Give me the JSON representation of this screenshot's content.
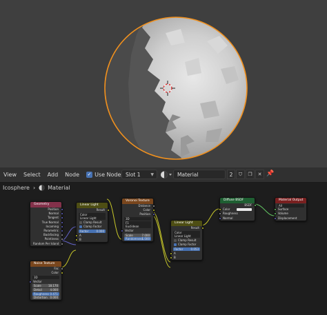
{
  "header": {
    "menu": [
      "View",
      "Select",
      "Add",
      "Node"
    ],
    "use_nodes_label": "Use Nodes",
    "slot_label": "Slot 1",
    "material_name": "Material",
    "user_count": "2"
  },
  "breadcrumb": {
    "object": "Icosphere",
    "material": "Material"
  },
  "nodes": {
    "geometry": {
      "title": "Geometry",
      "outputs": [
        "Position",
        "Normal",
        "Tangent",
        "True Normal",
        "Incoming",
        "Parametric",
        "Backfacing",
        "Pointiness",
        "Random Per Island"
      ]
    },
    "mix1": {
      "title": "Linear Light",
      "result": "Result",
      "type": "Color",
      "mode": "Linear Light",
      "clamp_result": "Clamp Result",
      "clamp_factor": "Clamp Factor",
      "factor_label": "Factor",
      "factor_value": "0.000",
      "a": "A",
      "b": "B"
    },
    "noise": {
      "title": "Noise Texture",
      "fac": "Fac",
      "color": "Color",
      "dim": "3D",
      "vector": "Vector",
      "scale_label": "Scale",
      "scale_value": "18.170",
      "detail_label": "Detail",
      "detail_value": "4.000",
      "rough_label": "Roughness",
      "rough_value": "0.471",
      "distortion_label": "Distortion",
      "distortion_value": "0.000"
    },
    "voronoi": {
      "title": "Voronoi Texture",
      "distance": "Distance",
      "color": "Color",
      "position": "Position",
      "dim": "3D",
      "feature": "F1",
      "metric": "Euclidean",
      "vector": "Vector",
      "scale_label": "Scale",
      "scale_value": "7.000",
      "random_label": "Randomness",
      "random_value": "1.000"
    },
    "mix2": {
      "title": "Linear Light",
      "result": "Result",
      "type": "Color",
      "mode": "Linear Light",
      "clamp_result": "Clamp Result",
      "clamp_factor": "Clamp Factor",
      "factor_label": "Factor",
      "factor_value": "0.053",
      "a": "A",
      "b": "B"
    },
    "bsdf": {
      "title": "Diffuse BSDF",
      "bsdf": "BSDF",
      "color": "Color",
      "roughness": "Roughness",
      "normal": "Normal"
    },
    "output": {
      "title": "Material Output",
      "target": "All",
      "surface": "Surface",
      "volume": "Volume",
      "displacement": "Displacement"
    }
  },
  "colors": {
    "accent": "#4772b3",
    "selection_outline": "#f0901e",
    "color_socket": "#c7c729",
    "vector_socket": "#6363c7",
    "float_socket": "#a1a1a1",
    "shader_socket": "#63c763"
  }
}
